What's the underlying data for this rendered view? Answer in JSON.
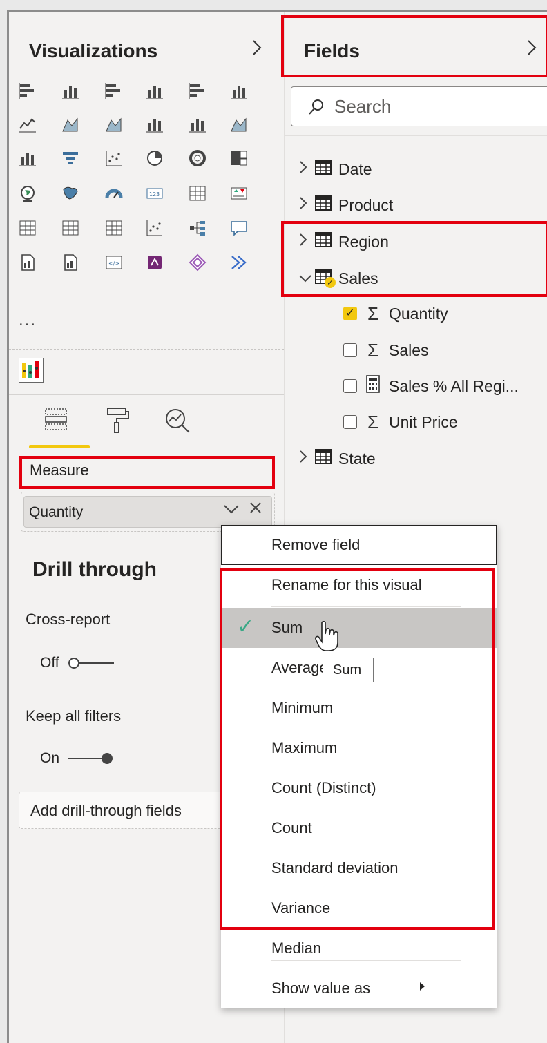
{
  "visualizations": {
    "title": "Visualizations",
    "collapse_icon": "chevron-right-icon",
    "icon_grid": [
      [
        "stacked-bar-icon",
        "stacked-column-icon",
        "clustered-bar-icon",
        "clustered-column-icon",
        "100-stacked-bar-icon",
        "100-stacked-column-icon"
      ],
      [
        "line-chart-icon",
        "area-chart-icon",
        "stacked-area-icon",
        "line-clustered-column-icon",
        "line-stacked-column-icon",
        "ribbon-chart-icon"
      ],
      [
        "waterfall-chart-icon",
        "funnel-chart-icon",
        "scatter-chart-icon",
        "pie-chart-icon",
        "donut-chart-icon",
        "treemap-icon"
      ],
      [
        "map-icon",
        "filled-map-icon",
        "gauge-icon",
        "card-icon",
        "multi-row-card-icon",
        "kpi-icon"
      ],
      [
        "slicer-icon",
        "table-icon",
        "matrix-icon",
        "key-influencers-icon",
        "decomposition-tree-icon",
        "qa-icon"
      ],
      [
        "smart-narrative-icon",
        "paginated-report-icon",
        "html-content-icon",
        "power-apps-icon",
        "power-automate-icon",
        "more-visuals-icon"
      ]
    ],
    "more_label": "...",
    "custom_visual_icon": "custom-visual-icon",
    "tabs": [
      {
        "name": "fields-tab",
        "icon": "fields-well-icon",
        "active": true
      },
      {
        "name": "format-tab",
        "icon": "paint-roller-icon",
        "active": false
      },
      {
        "name": "analytics-tab",
        "icon": "analytics-magnifier-icon",
        "active": false
      }
    ],
    "measure_label": "Measure",
    "measure_value": "Quantity",
    "drill_through": {
      "title": "Drill through",
      "cross_report_label": "Cross-report",
      "cross_report_state": "Off",
      "keep_filters_label": "Keep all filters",
      "keep_filters_state": "On",
      "drop_placeholder": "Add drill-through fields"
    }
  },
  "fields": {
    "title": "Fields",
    "collapse_icon": "chevron-right-icon",
    "search_placeholder": "Search",
    "tables": [
      {
        "name": "Date",
        "expanded": false
      },
      {
        "name": "Product",
        "expanded": false
      },
      {
        "name": "Region",
        "expanded": false
      },
      {
        "name": "Sales",
        "expanded": true
      },
      {
        "name": "State",
        "expanded": false
      }
    ],
    "sales_fields": [
      {
        "label": "Quantity",
        "type": "sigma",
        "checked": true
      },
      {
        "label": "Sales",
        "type": "sigma",
        "checked": false
      },
      {
        "label": "Sales % All Regi...",
        "type": "calculator",
        "checked": false
      },
      {
        "label": "Unit Price",
        "type": "sigma",
        "checked": false
      }
    ]
  },
  "context_menu": {
    "items": [
      "Remove field",
      "Rename for this visual",
      "Sum",
      "Average",
      "Minimum",
      "Maximum",
      "Count (Distinct)",
      "Count",
      "Standard deviation",
      "Variance",
      "Median",
      "Show value as"
    ],
    "selected": "Sum",
    "tooltip": "Sum"
  },
  "colors": {
    "highlight_red": "#e3000f",
    "accent_yellow": "#f2c80f",
    "check_green": "#3aa886"
  }
}
